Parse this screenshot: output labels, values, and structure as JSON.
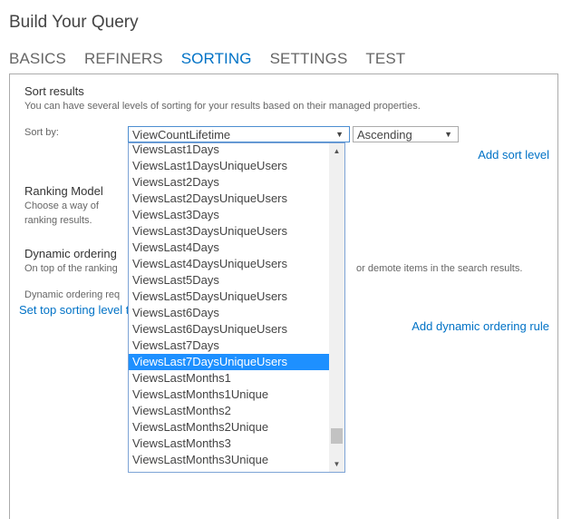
{
  "page": {
    "title": "Build Your Query"
  },
  "tabs": [
    {
      "label": "BASICS",
      "active": false
    },
    {
      "label": "REFINERS",
      "active": false
    },
    {
      "label": "SORTING",
      "active": true
    },
    {
      "label": "SETTINGS",
      "active": false
    },
    {
      "label": "TEST",
      "active": false
    }
  ],
  "sorting": {
    "section_title": "Sort results",
    "section_description": "You can have several levels of sorting for your results based on their managed properties.",
    "sort_by_label": "Sort by:",
    "sort_by_value": "ViewCountLifetime",
    "direction_value": "Ascending",
    "add_sort_level": "Add sort level",
    "dropdown_options": [
      "ViewsLast1Days",
      "ViewsLast1DaysUniqueUsers",
      "ViewsLast2Days",
      "ViewsLast2DaysUniqueUsers",
      "ViewsLast3Days",
      "ViewsLast3DaysUniqueUsers",
      "ViewsLast4Days",
      "ViewsLast4DaysUniqueUsers",
      "ViewsLast5Days",
      "ViewsLast5DaysUniqueUsers",
      "ViewsLast6Days",
      "ViewsLast6DaysUniqueUsers",
      "ViewsLast7Days",
      "ViewsLast7DaysUniqueUsers",
      "ViewsLastMonths1",
      "ViewsLastMonths1Unique",
      "ViewsLastMonths2",
      "ViewsLastMonths2Unique",
      "ViewsLastMonths3",
      "ViewsLastMonths3Unique"
    ],
    "highlighted_option": "ViewsLast7DaysUniqueUsers",
    "scroll_position_fraction": 0.9
  },
  "ranking": {
    "title": "Ranking Model",
    "description_line1": "Choose a way of",
    "description_line2": "ranking results."
  },
  "dynamic": {
    "title": "Dynamic ordering",
    "description_start": "On top of the ranking",
    "description_end": "or demote items in the search results.",
    "requirement_text": "Dynamic ordering req",
    "set_top_link": "Set top sorting level t",
    "add_rule_link": "Add dynamic ordering rule"
  },
  "icons": {
    "dropdown_arrow": "▼",
    "scroll_up": "▲",
    "scroll_down": "▼"
  },
  "colors": {
    "accent": "#0072c6",
    "selected_option_bg": "#1e90ff"
  }
}
